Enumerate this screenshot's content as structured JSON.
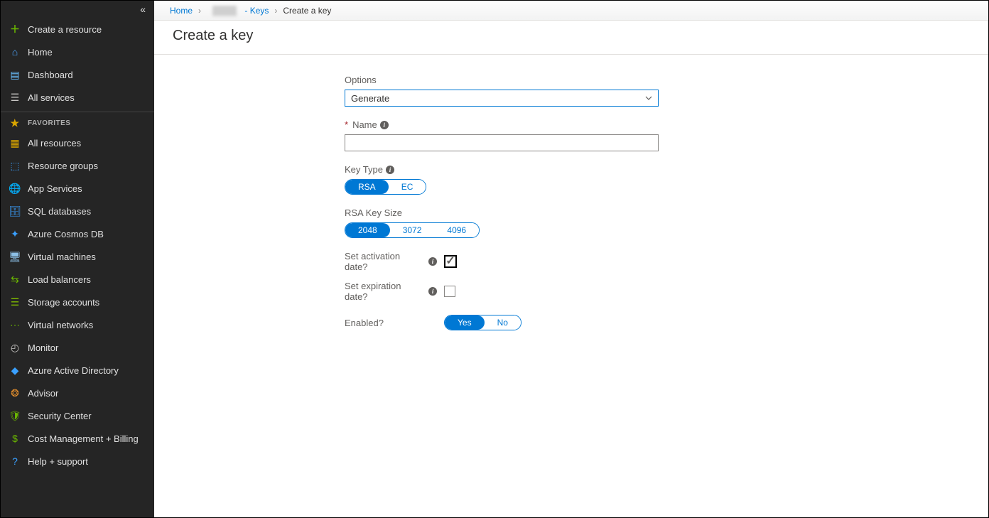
{
  "sidebar": {
    "collapse_glyph": "«",
    "items": [
      {
        "label": "Create a resource",
        "icon": "plus",
        "color": "#6bb700"
      },
      {
        "label": "Home",
        "icon": "home",
        "color": "#4da6ff"
      },
      {
        "label": "Dashboard",
        "icon": "dashboard",
        "color": "#69c0ff"
      },
      {
        "label": "All services",
        "icon": "list",
        "color": "#c8c6c4"
      }
    ],
    "favorites_label": "FAVORITES",
    "favorites": [
      {
        "label": "All resources",
        "icon": "grid",
        "color": "#d9a500"
      },
      {
        "label": "Resource groups",
        "icon": "cube",
        "color": "#3aa0ff"
      },
      {
        "label": "App Services",
        "icon": "globe",
        "color": "#3aa0ff"
      },
      {
        "label": "SQL databases",
        "icon": "sql",
        "color": "#3aa0ff"
      },
      {
        "label": "Azure Cosmos DB",
        "icon": "cosmos",
        "color": "#3aa0ff"
      },
      {
        "label": "Virtual machines",
        "icon": "vm",
        "color": "#8cbfe6"
      },
      {
        "label": "Load balancers",
        "icon": "lb",
        "color": "#6bb700"
      },
      {
        "label": "Storage accounts",
        "icon": "storage",
        "color": "#7fba00"
      },
      {
        "label": "Virtual networks",
        "icon": "vnet",
        "color": "#6bb700"
      },
      {
        "label": "Monitor",
        "icon": "monitor",
        "color": "#c8c6c4"
      },
      {
        "label": "Azure Active Directory",
        "icon": "aad",
        "color": "#3aa0ff"
      },
      {
        "label": "Advisor",
        "icon": "advisor",
        "color": "#e8912d"
      },
      {
        "label": "Security Center",
        "icon": "security",
        "color": "#6bb700"
      },
      {
        "label": "Cost Management + Billing",
        "icon": "cost",
        "color": "#6bb700"
      },
      {
        "label": "Help + support",
        "icon": "help",
        "color": "#3aa0ff"
      }
    ]
  },
  "breadcrumb": {
    "home": "Home",
    "vault_suffix": "- Keys",
    "current": "Create a key",
    "sep": "›"
  },
  "page_title": "Create a key",
  "form": {
    "options_label": "Options",
    "options_value": "Generate",
    "name_label": "Name",
    "name_value": "",
    "key_type_label": "Key Type",
    "key_type_options": [
      "RSA",
      "EC"
    ],
    "key_type_selected": "RSA",
    "rsa_size_label": "RSA Key Size",
    "rsa_size_options": [
      "2048",
      "3072",
      "4096"
    ],
    "rsa_size_selected": "2048",
    "activation_label": "Set activation date?",
    "activation_checked": true,
    "expiration_label": "Set expiration date?",
    "expiration_checked": false,
    "enabled_label": "Enabled?",
    "enabled_options": [
      "Yes",
      "No"
    ],
    "enabled_selected": "Yes"
  }
}
